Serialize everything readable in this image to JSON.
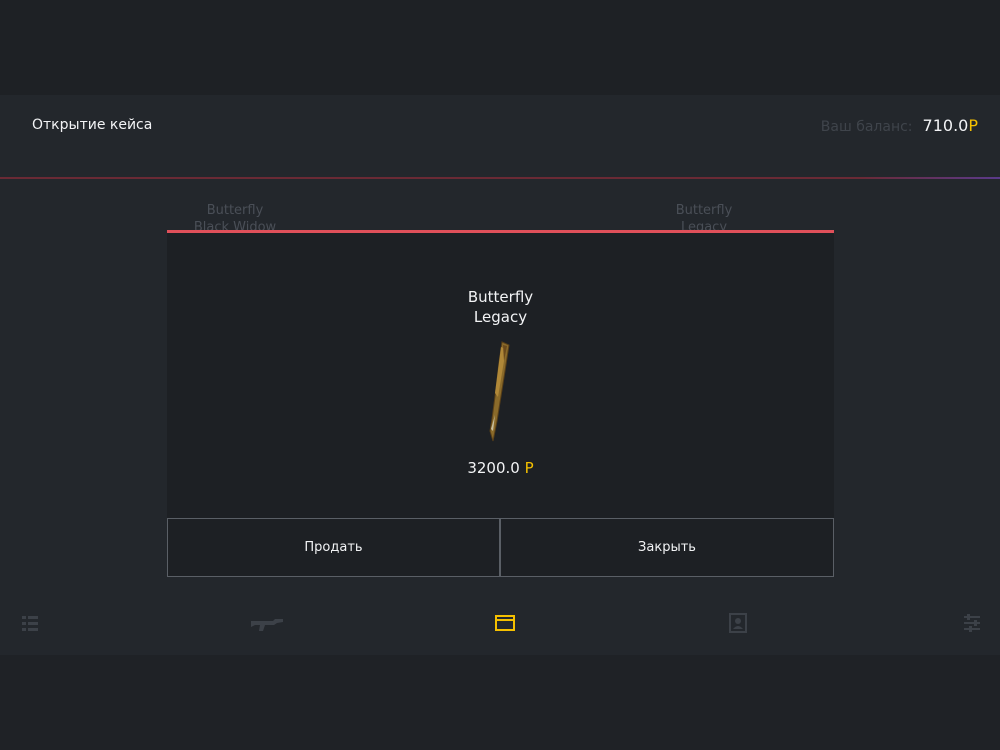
{
  "header": {
    "title": "Открытие кейса",
    "balance_label": "Ваш баланс:",
    "balance_value": "710.0",
    "currency": "Р"
  },
  "roulette": {
    "items": [
      {
        "line1": "Butterfly",
        "line2": "Black Widow"
      },
      {
        "line1": "Butterfly",
        "line2": "Legacy"
      }
    ]
  },
  "modal": {
    "item_name_line1": "Butterfly",
    "item_name_line2": "Legacy",
    "price": "3200.0",
    "currency": "Р",
    "sell_label": "Продать",
    "close_label": "Закрыть"
  },
  "bottom_nav": {
    "items": [
      {
        "icon": "list-icon",
        "active": false
      },
      {
        "icon": "rifle-icon",
        "active": false
      },
      {
        "icon": "case-icon",
        "active": true
      },
      {
        "icon": "profile-icon",
        "active": false
      },
      {
        "icon": "settings-list-icon",
        "active": false
      }
    ]
  },
  "colors": {
    "accent": "#f5c000",
    "modal_top_border": "#e0505a"
  }
}
